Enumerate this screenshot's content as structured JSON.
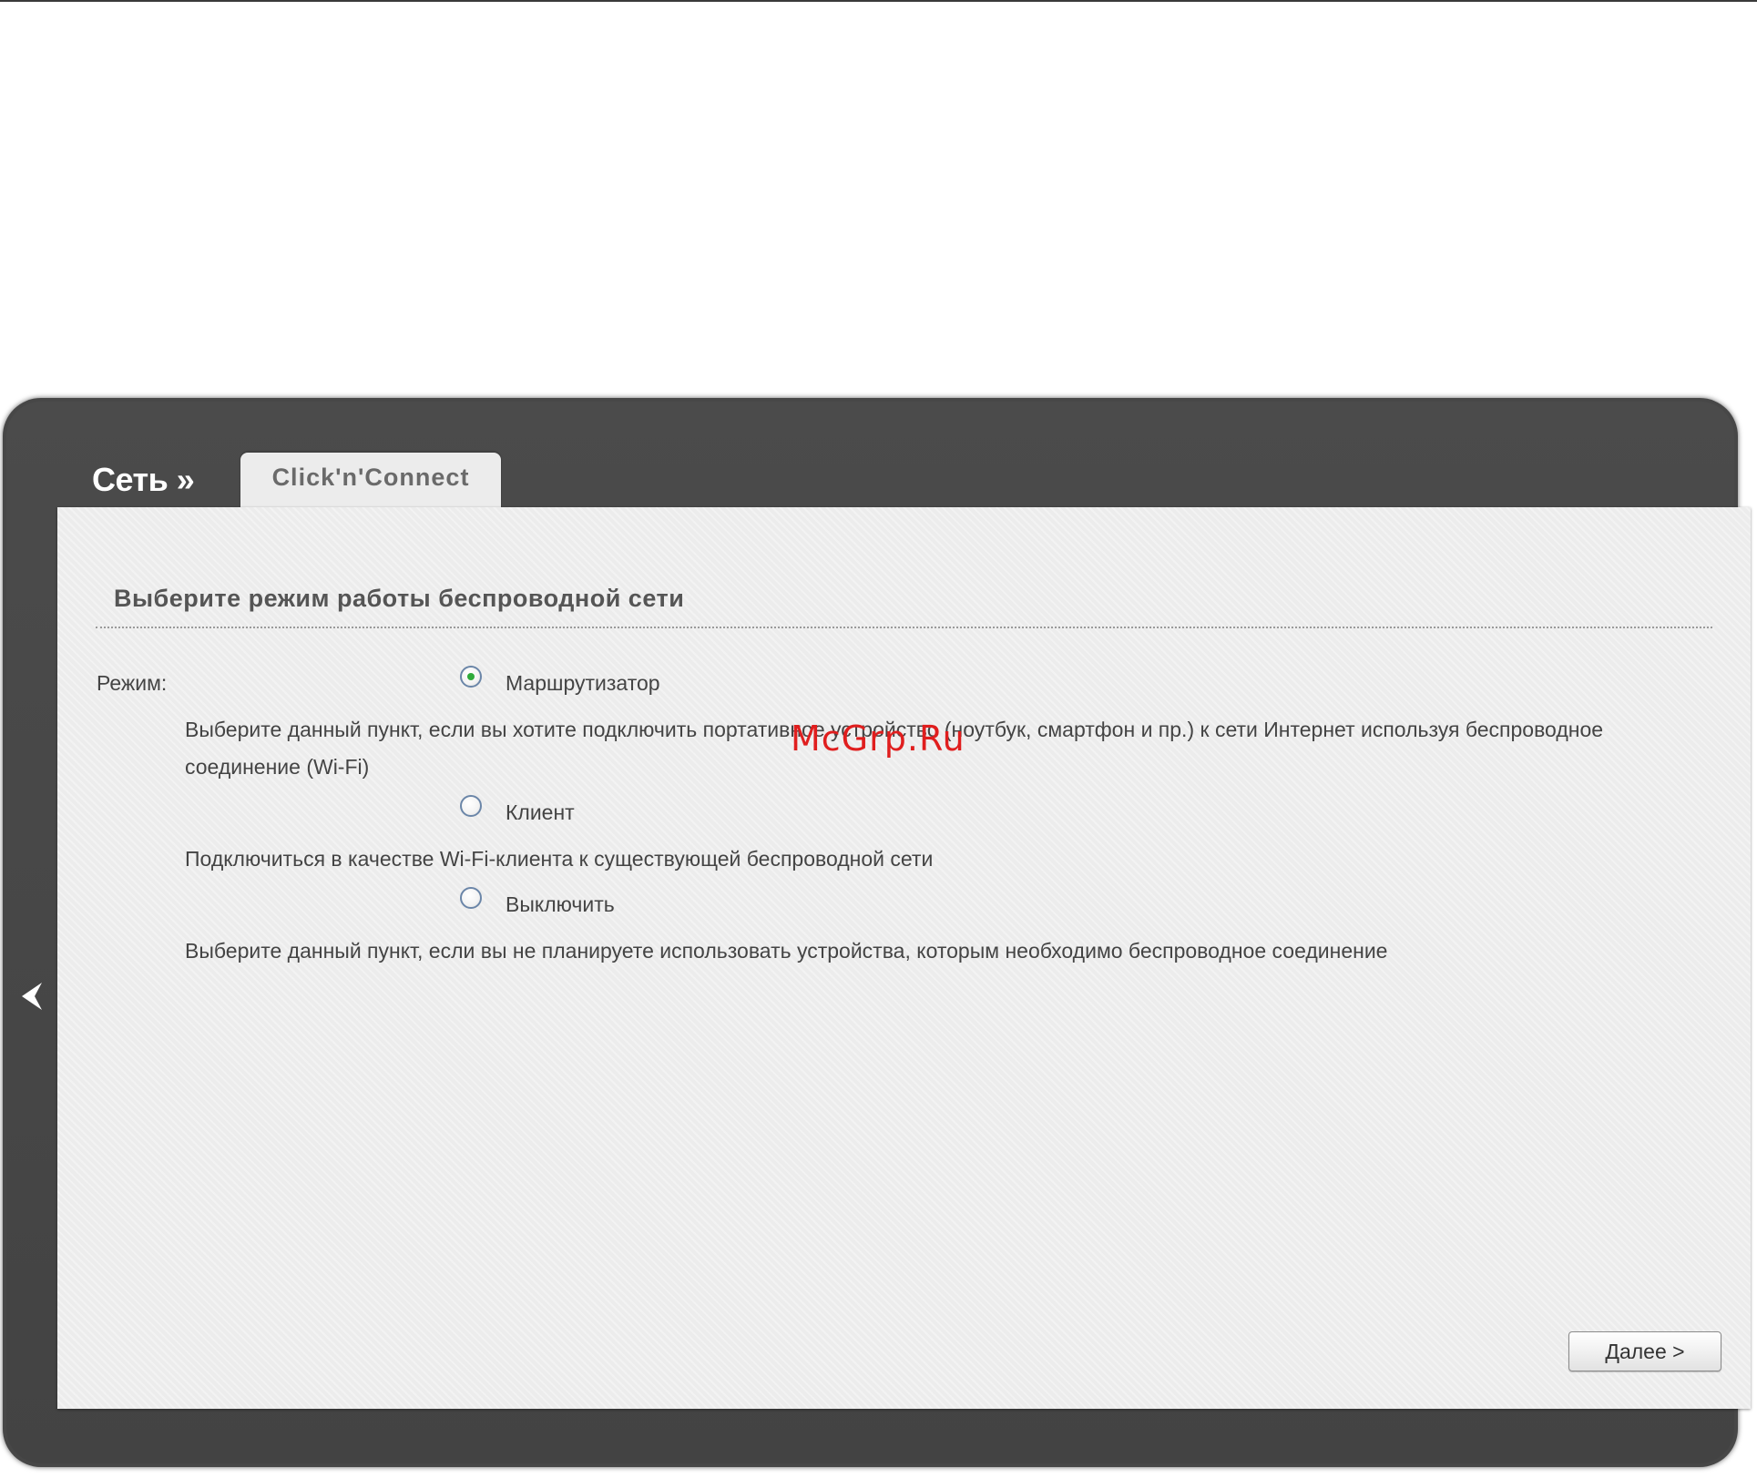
{
  "header": {
    "breadcrumb": "Сеть »",
    "active_tab": "Click'n'Connect"
  },
  "section": {
    "title": "Выберите режим работы беспроводной сети"
  },
  "form": {
    "mode_label": "Режим:",
    "options": [
      {
        "label": "Маршрутизатор",
        "selected": true,
        "description": "Выберите данный пункт, если вы хотите подключить портативное устройство (ноутбук, смартфон и пр.) к сети Интернет используя беспроводное соединение (Wi-Fi)"
      },
      {
        "label": "Клиент",
        "selected": false,
        "description": "Подключиться в качестве Wi-Fi-клиента к существующей беспроводной сети"
      },
      {
        "label": "Выключить",
        "selected": false,
        "description": "Выберите данный пункт, если вы не планируете использовать устройства, которым необходимо беспроводное соединение"
      }
    ]
  },
  "actions": {
    "next_label": "Далее >"
  },
  "watermark": "McGrp.Ru",
  "icons": {
    "back": "back-arrow-icon"
  },
  "colors": {
    "frame": "#474747",
    "panel": "#ececec",
    "radio_selected_dot": "#2faa3a",
    "watermark": "#e01e1e"
  }
}
